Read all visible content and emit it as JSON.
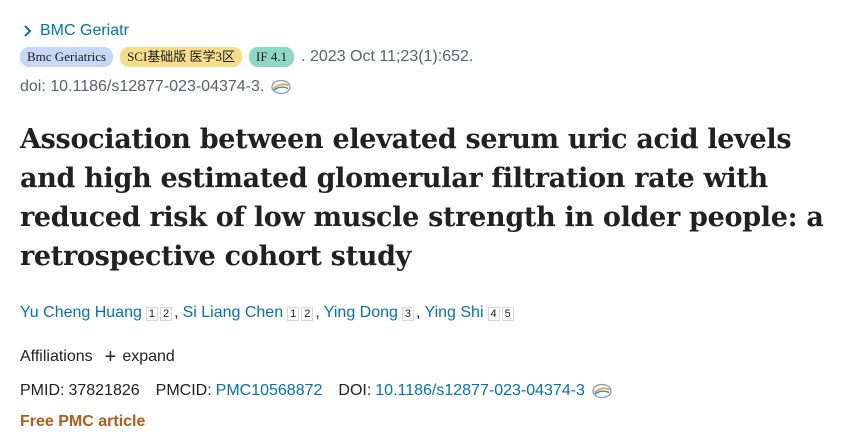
{
  "journal": {
    "link_label": "BMC Geriatr"
  },
  "badges": {
    "journal": "Bmc Geriatrics",
    "sci": "SCI基础版 医学3区",
    "impact_factor": "IF 4.1"
  },
  "citation": {
    "date_volume": ". 2023 Oct 11;23(1):652.",
    "doi_text": "doi: 10.1186/s12877-023-04374-3."
  },
  "article": {
    "title": "Association between elevated serum uric acid levels and high estimated glomerular filtration rate with reduced risk of low muscle strength in older people: a retrospective cohort study"
  },
  "authors": [
    {
      "name": "Yu Cheng Huang",
      "affils": [
        "1",
        "2"
      ],
      "sep": ","
    },
    {
      "name": "Si Liang Chen",
      "affils": [
        "1",
        "2"
      ],
      "sep": ","
    },
    {
      "name": "Ying Dong",
      "affils": [
        "3"
      ],
      "sep": ","
    },
    {
      "name": "Ying Shi",
      "affils": [
        "4",
        "5"
      ],
      "sep": ""
    }
  ],
  "affiliations": {
    "label": "Affiliations",
    "expand_label": "expand"
  },
  "identifiers": {
    "pmid_label": "PMID:",
    "pmid": "37821826",
    "pmcid_label": "PMCID:",
    "pmcid": "PMC10568872",
    "doi_label": "DOI:",
    "doi": "10.1186/s12877-023-04374-3"
  },
  "free_pmc": "Free PMC article",
  "colors": {
    "link": "#0071bc",
    "free_pmc": "#b55a1a",
    "badge_journal": "#c9d7f7",
    "badge_sci": "#f5de8a",
    "badge_if": "#8fd8c4"
  },
  "icons": {
    "journal_chevron": "chevron-right-icon",
    "external": "external-resource-icon"
  }
}
